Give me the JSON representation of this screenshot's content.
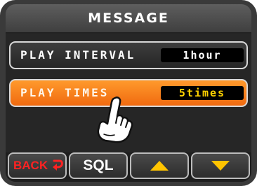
{
  "screen": {
    "title": "MESSAGE"
  },
  "settings": [
    {
      "label": "PLAY INTERVAL",
      "value": "1hour",
      "selected": false
    },
    {
      "label": "PLAY TIMES",
      "value": "5times",
      "selected": true
    }
  ],
  "bottom_buttons": {
    "back_label": "BACK",
    "sql_label": "SQL",
    "up_icon": "triangle-up-icon",
    "down_icon": "triangle-down-icon"
  },
  "colors": {
    "accent_orange": "#f27a18",
    "value_highlight": "#ffd200",
    "back_red": "#ff2222",
    "triangle_yellow": "#ffc400"
  }
}
